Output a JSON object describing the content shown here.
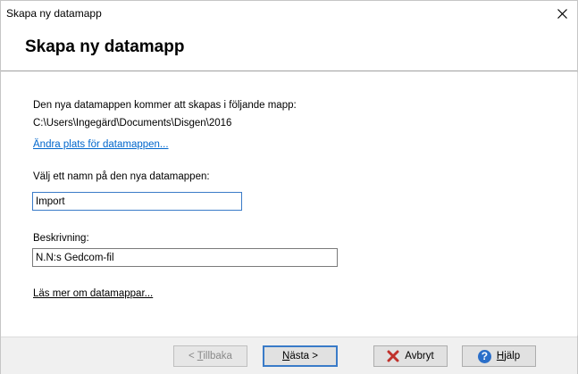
{
  "window": {
    "title": "Skapa ny datamapp"
  },
  "header": {
    "title": "Skapa ny datamapp"
  },
  "content": {
    "intro": "Den nya datamappen kommer att skapas i följande mapp:",
    "path": "C:\\Users\\Ingegärd\\Documents\\Disgen\\2016",
    "change_location_link": "Ändra plats för datamappen...",
    "name_label": "Välj ett namn på den nya datamappen:",
    "name_value": "Import",
    "description_label": "Beskrivning:",
    "description_value": "N.N:s Gedcom-fil",
    "read_more_link": "Läs mer om datamappar..."
  },
  "footer": {
    "back": {
      "underlined": "T",
      "rest": "illbaka",
      "prefix": "< "
    },
    "next": {
      "underlined": "N",
      "rest": "ästa >"
    },
    "cancel": {
      "label": "Avbryt",
      "icon": "red-x-icon"
    },
    "help": {
      "underlined": "H",
      "rest": "jälp",
      "icon": "help-question-icon"
    }
  },
  "colors": {
    "link": "#0066cc",
    "focus_border": "#3a7bc8",
    "cancel_icon": "#c0312b",
    "help_icon": "#2b6fc9"
  }
}
